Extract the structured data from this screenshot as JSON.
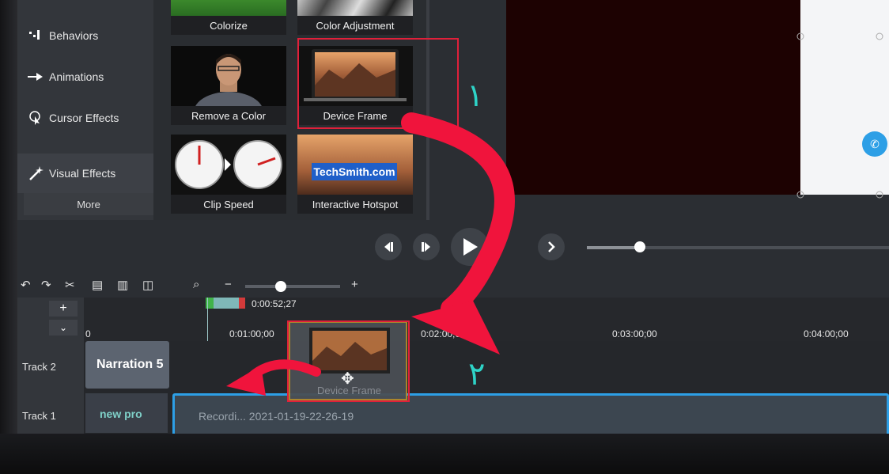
{
  "sidebar": {
    "items": [
      {
        "label": "Behaviors",
        "icon": "behaviors-icon"
      },
      {
        "label": "Animations",
        "icon": "animations-icon"
      },
      {
        "label": "Cursor Effects",
        "icon": "cursor-effects-icon"
      },
      {
        "label": "Visual Effects",
        "icon": "visual-effects-icon",
        "active": true
      }
    ],
    "more_label": "More"
  },
  "effects": [
    {
      "label": "Colorize"
    },
    {
      "label": "Color Adjustment"
    },
    {
      "label": "Remove a Color"
    },
    {
      "label": "Device Frame",
      "highlighted": true
    },
    {
      "label": "Clip Speed"
    },
    {
      "label": "Interactive Hotspot",
      "thumb_text": "TechSmith.com"
    }
  ],
  "annotations": {
    "step1": "١",
    "step2": "٢",
    "highlight_color": "#e0203a",
    "arrow_color": "#f0143c",
    "marker_color": "#2ed3c7"
  },
  "timeline": {
    "playhead_time": "0:00:52;27",
    "ruler_labels": [
      "0",
      "0:01:00;00",
      "0:02:00;00",
      "0:03:00;00",
      "0:04:00;00"
    ],
    "tracks": [
      {
        "name": "Track 2",
        "clip": "Narration 5"
      },
      {
        "name": "Track 1",
        "clip": "new pro",
        "clip2": "Recordi... 2021-01-19-22-26-19"
      }
    ],
    "dragged_clip": "Device Frame"
  },
  "colors": {
    "accent": "#2d9fe6",
    "active_border": "#6aa58e",
    "panel": "#33363b",
    "canvas": "#1d0202"
  }
}
